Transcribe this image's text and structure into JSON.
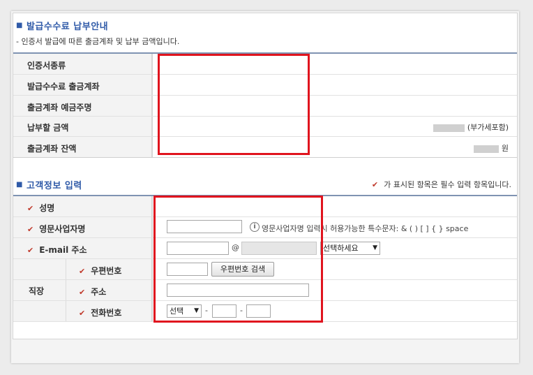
{
  "fee_section": {
    "title": "발급수수료 납부안내",
    "desc": "- 인증서 발급에 따른 출금계좌 및 납부 금액입니다.",
    "rows": [
      {
        "label": "인증서종류"
      },
      {
        "label": "발급수수료 출금계좌"
      },
      {
        "label": "출금계좌 예금주명"
      },
      {
        "label": "납부할 금액",
        "suffix": "(부가세포함)"
      },
      {
        "label": "출금계좌 잔액",
        "suffix": "원"
      }
    ]
  },
  "customer_section": {
    "title": "고객정보 입력",
    "required_note": "가 표시된 항목은 필수 입력 항목입니다.",
    "name_label": "성명",
    "business_label": "영문사업자명",
    "business_hint": "영문사업자명 입력시 허용가능한 특수문자: & ( ) [ ] { } space",
    "email_label": "E-mail 주소",
    "email_at": "@",
    "email_domain_select": "선택하세요",
    "workplace_label": "직장",
    "postal_label": "우편번호",
    "postal_search_button": "우편번호 검색",
    "address_label": "주소",
    "phone_label": "전화번호",
    "phone_select": "선택",
    "phone_dash": "-"
  },
  "icons": {
    "check": "checkmark-icon",
    "info": "info-icon",
    "dropdown": "chevron-down-icon"
  },
  "colors": {
    "section_title": "#2f5aa8",
    "check_mark": "#c0392b",
    "highlight_box": "#e0141e"
  }
}
